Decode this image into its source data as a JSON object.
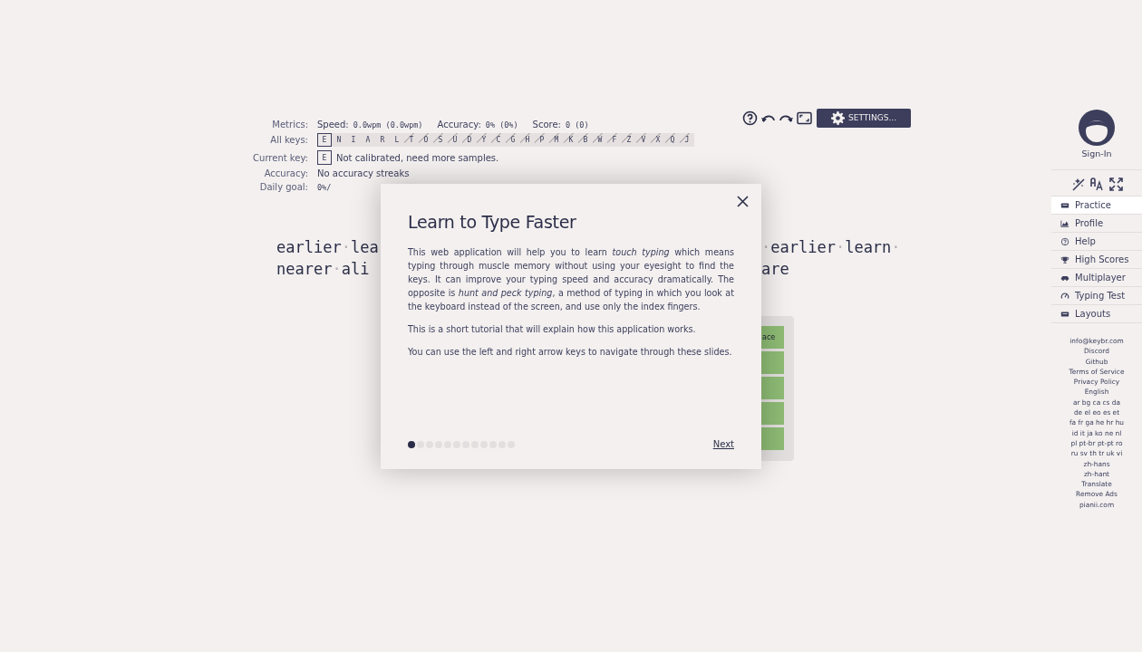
{
  "toolbar": {
    "settings_label": "SETTINGS..."
  },
  "metrics": {
    "label": "Metrics:",
    "speed_label": "Speed:",
    "speed": "0.0wpm",
    "speed_avg": "(0.0wpm)",
    "accuracy_label": "Accuracy:",
    "accuracy": "0%",
    "accuracy_avg": "(0%)",
    "score_label": "Score:",
    "score": "0",
    "score_avg": "(0)"
  },
  "all_keys": {
    "label": "All keys:",
    "keys": [
      {
        "key": "E",
        "selected": true,
        "locked": false
      },
      {
        "key": "N",
        "selected": false,
        "locked": false
      },
      {
        "key": "I",
        "selected": false,
        "locked": false
      },
      {
        "key": "A",
        "selected": false,
        "locked": false
      },
      {
        "key": "R",
        "selected": false,
        "locked": false
      },
      {
        "key": "L",
        "selected": false,
        "locked": false
      },
      {
        "key": "T",
        "selected": false,
        "locked": true
      },
      {
        "key": "O",
        "selected": false,
        "locked": true
      },
      {
        "key": "S",
        "selected": false,
        "locked": true
      },
      {
        "key": "U",
        "selected": false,
        "locked": true
      },
      {
        "key": "D",
        "selected": false,
        "locked": true
      },
      {
        "key": "Y",
        "selected": false,
        "locked": true
      },
      {
        "key": "C",
        "selected": false,
        "locked": true
      },
      {
        "key": "G",
        "selected": false,
        "locked": true
      },
      {
        "key": "H",
        "selected": false,
        "locked": true
      },
      {
        "key": "P",
        "selected": false,
        "locked": true
      },
      {
        "key": "M",
        "selected": false,
        "locked": true
      },
      {
        "key": "K",
        "selected": false,
        "locked": true
      },
      {
        "key": "B",
        "selected": false,
        "locked": true
      },
      {
        "key": "W",
        "selected": false,
        "locked": true
      },
      {
        "key": "F",
        "selected": false,
        "locked": true
      },
      {
        "key": "Z",
        "selected": false,
        "locked": true
      },
      {
        "key": "V",
        "selected": false,
        "locked": true
      },
      {
        "key": "X",
        "selected": false,
        "locked": true
      },
      {
        "key": "Q",
        "selected": false,
        "locked": true
      },
      {
        "key": "J",
        "selected": false,
        "locked": true
      }
    ]
  },
  "current_key": {
    "label": "Current key:",
    "key": "E",
    "note": "Not calibrated, need more samples."
  },
  "accuracy": {
    "label": "Accuracy:",
    "value": "No accuracy streaks"
  },
  "daily_goal": {
    "label": "Daily goal:",
    "value": "0%/"
  },
  "lesson_lines": [
    {
      "left": "earlier·lea",
      "right": "·earlier·learn·"
    },
    {
      "left": "nearer·ali",
      "right": "are"
    }
  ],
  "keyboard": {
    "keys": [
      "ace"
    ]
  },
  "dialog": {
    "title": "Learn to Type Faster",
    "paragraphs": [
      "This web application will help you to learn *touch typing* which means typing through muscle memory without using your eyesight to find the keys. It can improve your typing speed and accuracy dramatically. The opposite is *hunt and peck typing*, a method of typing in which you look at the keyboard instead of the screen, and use only the index fingers.",
      "This is a short tutorial that will explain how this application works.",
      "You can use the left and right arrow keys to navigate through these slides."
    ],
    "slides": [
      {
        "selected": true
      },
      {
        "selected": false
      },
      {
        "selected": false
      },
      {
        "selected": false
      },
      {
        "selected": false
      },
      {
        "selected": false
      },
      {
        "selected": false
      },
      {
        "selected": false
      },
      {
        "selected": false
      },
      {
        "selected": false
      },
      {
        "selected": false
      },
      {
        "selected": false
      }
    ],
    "next_label": "Next"
  },
  "sidebar": {
    "sign_in": "Sign-In",
    "items": [
      {
        "label": "Practice",
        "selected": true
      },
      {
        "label": "Profile",
        "selected": false
      },
      {
        "label": "Help",
        "selected": false
      },
      {
        "label": "High Scores",
        "selected": false
      },
      {
        "label": "Multiplayer",
        "selected": false
      },
      {
        "label": "Typing Test",
        "selected": false
      },
      {
        "label": "Layouts",
        "selected": false
      }
    ],
    "links": [
      "info@keybr.com",
      "Discord",
      "Github",
      "Terms of Service",
      "Privacy Policy",
      "English",
      "ar bg ca cs da",
      "de el eo es et",
      "fa fr ga he hr hu",
      "id it ja ko ne nl",
      "pl pt-br pt-pt ro",
      "ru sv th tr uk vi",
      "zh-hans",
      "zh-hant",
      "Translate",
      "Remove Ads",
      "pianii.com"
    ]
  }
}
